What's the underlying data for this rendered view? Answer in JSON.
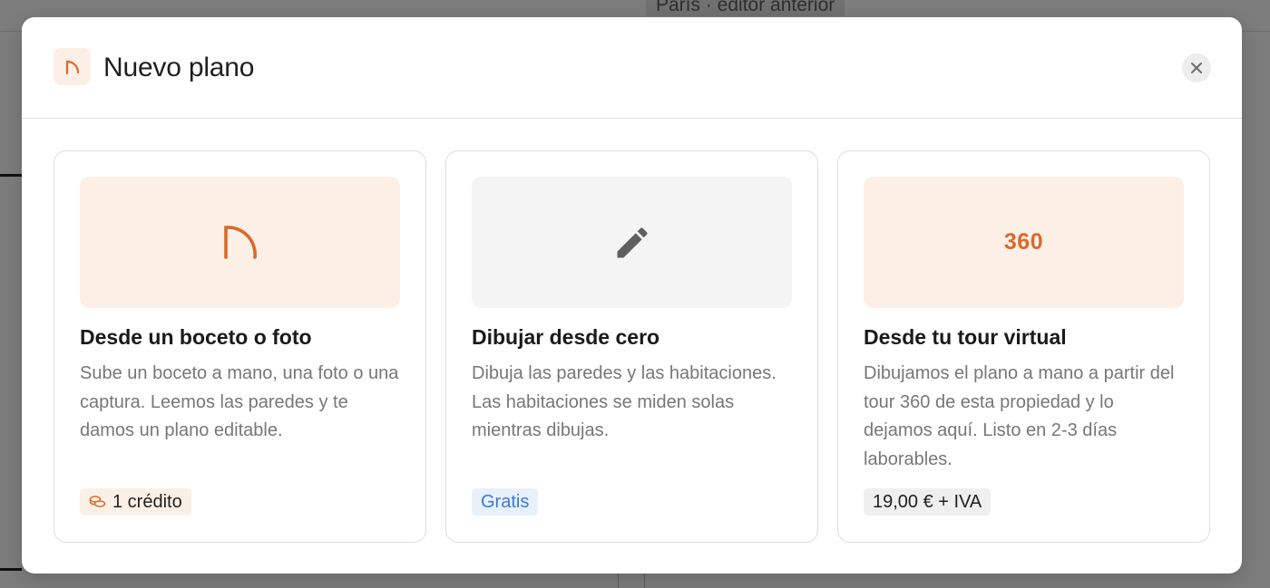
{
  "background": {
    "title": "París · editor anterior"
  },
  "modal": {
    "title": "Nuevo plano",
    "header_icon": "arch-icon",
    "close_icon": "close-icon"
  },
  "cards": [
    {
      "icon": "arch-icon",
      "title": "Desde un boceto o foto",
      "description": "Sube un boceto a mano, una foto o una captura. Leemos las paredes y te damos un plano editable.",
      "badge_icon": "coins-icon",
      "badge": "1 crédito"
    },
    {
      "icon": "pencil-icon",
      "title": "Dibujar desde cero",
      "description": "Dibuja las paredes y las habitaciones. Las habitaciones se miden solas mientras dibujas.",
      "badge": "Gratis"
    },
    {
      "media_text": "360",
      "title": "Desde tu tour virtual",
      "description": "Dibujamos el plano a mano a partir del tour 360 de esta propiedad y lo dejamos aquí. Listo en 2-3 días laborables.",
      "badge": "19,00 € + IVA"
    }
  ],
  "colors": {
    "accent": "#d9692c",
    "accent_bg": "#fcf0e6",
    "free_text": "#3a7bd5",
    "free_bg": "#e8f0fb",
    "overlay": "#7d7d7d"
  }
}
